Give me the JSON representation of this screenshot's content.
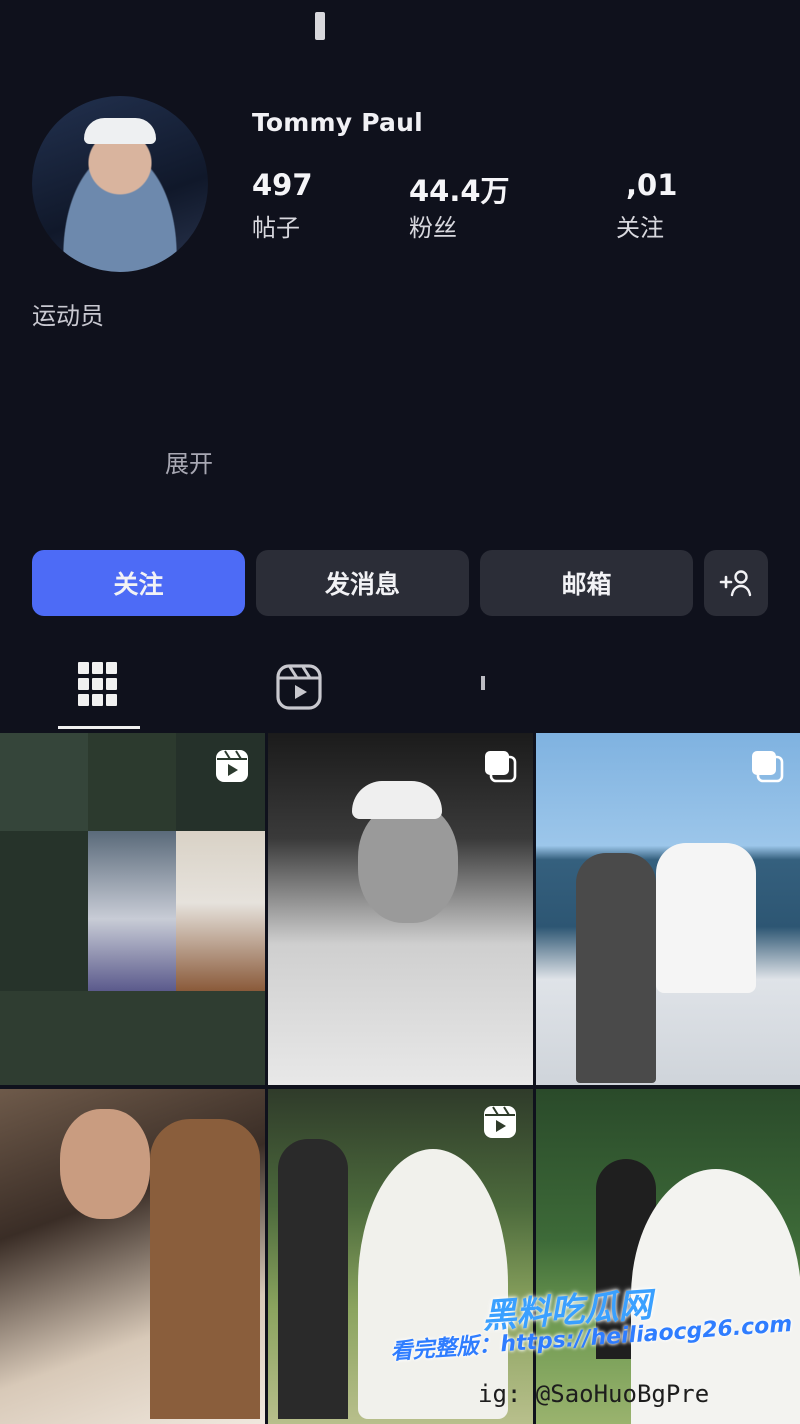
{
  "profile": {
    "username": "Tommy Paul",
    "category": "运动员",
    "expand_label": "展开",
    "stats": [
      {
        "value": "497",
        "label": "帖子"
      },
      {
        "value": "44.4万",
        "label": "粉丝"
      },
      {
        "value": ",01",
        "label": "关注"
      }
    ]
  },
  "actions": {
    "follow_label": "关注",
    "message_label": "发消息",
    "email_label": "邮箱",
    "suggest_icon": "add-person-icon"
  },
  "tabs": [
    {
      "name": "grid",
      "icon": "grid-icon",
      "selected": true
    },
    {
      "name": "reels",
      "icon": "reels-icon",
      "selected": false
    },
    {
      "name": "tagged",
      "icon": "tagged-icon",
      "selected": false
    }
  ],
  "posts": [
    {
      "badge": "reels-icon"
    },
    {
      "badge": "carousel-icon"
    },
    {
      "badge": "carousel-icon"
    },
    {
      "badge": ""
    },
    {
      "badge": "reels-icon"
    },
    {
      "badge": ""
    }
  ],
  "watermark": {
    "title": "黑料吃瓜网",
    "url_prefix": "看完整版：",
    "url": "https://heiliaocg26.com",
    "handle": "ig: @SaoHuoBgPre"
  },
  "colors": {
    "background": "#0f111c",
    "primary_button": "#4d6bf6",
    "secondary_button": "#2b2d37"
  }
}
